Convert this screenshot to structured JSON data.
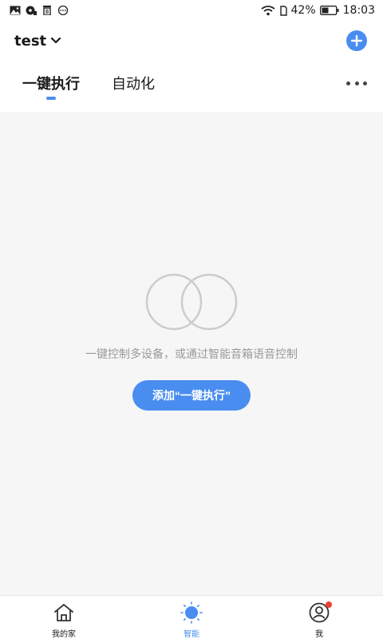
{
  "status_bar": {
    "battery": "42%",
    "time": "18:03",
    "icons": [
      "gallery-icon",
      "music-icon",
      "trash-icon",
      "more-icon",
      "wifi-icon",
      "sim-icon",
      "battery-icon"
    ]
  },
  "header": {
    "home_name": "test"
  },
  "tabs": [
    {
      "label": "一键执行",
      "active": true
    },
    {
      "label": "自动化",
      "active": false
    }
  ],
  "empty_state": {
    "message": "一键控制多设备，或通过智能音箱语音控制",
    "button_label": "添加“一键执行”"
  },
  "bottom_nav": [
    {
      "label": "我的家",
      "icon": "home-icon",
      "active": false
    },
    {
      "label": "智能",
      "icon": "sun-icon",
      "active": true
    },
    {
      "label": "我",
      "icon": "profile-icon",
      "active": false
    }
  ],
  "colors": {
    "accent": "#4a8df0",
    "background": "#f6f6f7",
    "badge": "#f03c2e"
  }
}
